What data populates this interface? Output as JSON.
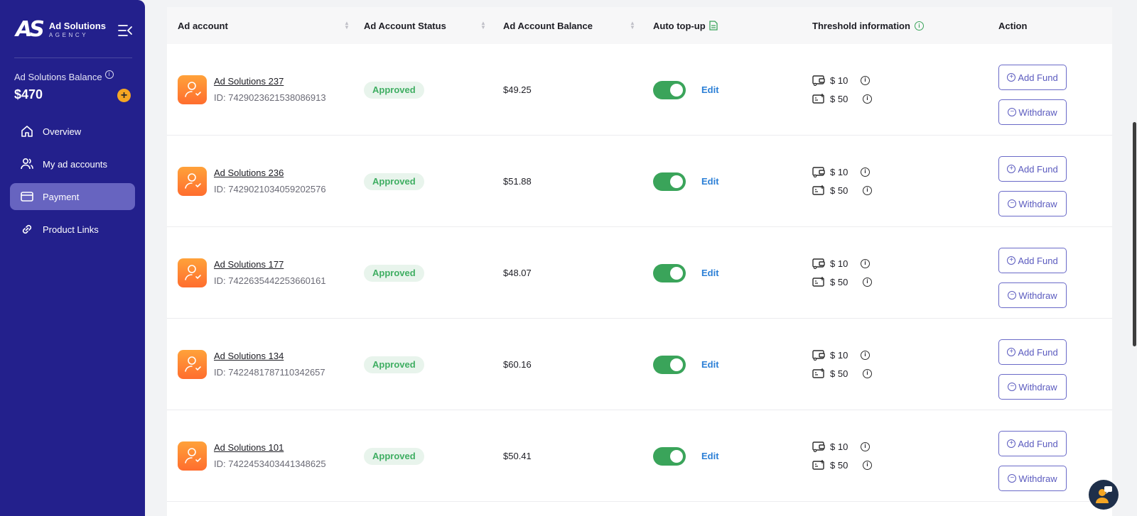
{
  "sidebar": {
    "logo_mark": "AS",
    "logo_title": "Ad Solutions",
    "logo_subtitle": "AGENCY",
    "balance_label": "Ad Solutions Balance",
    "balance_value": "$470",
    "add_symbol": "+",
    "items": [
      {
        "label": "Overview",
        "icon": "home-icon"
      },
      {
        "label": "My ad accounts",
        "icon": "users-icon"
      },
      {
        "label": "Payment",
        "icon": "card-icon",
        "active": true
      },
      {
        "label": "Product Links",
        "icon": "link-icon"
      }
    ]
  },
  "table": {
    "headers": {
      "account": "Ad account",
      "status": "Ad Account Status",
      "balance": "Ad Account Balance",
      "topup": "Auto top-up",
      "threshold": "Threshold information",
      "action": "Action"
    },
    "rows": [
      {
        "name": "Ad Solutions 237",
        "id": "ID: 7429023621538086913",
        "status": "Approved",
        "balance": "$49.25",
        "edit": "Edit",
        "threshold_min": "$ 10",
        "threshold_topup": "$ 50",
        "add_fund": "Add Fund",
        "withdraw": "Withdraw"
      },
      {
        "name": "Ad Solutions 236",
        "id": "ID: 7429021034059202576",
        "status": "Approved",
        "balance": "$51.88",
        "edit": "Edit",
        "threshold_min": "$ 10",
        "threshold_topup": "$ 50",
        "add_fund": "Add Fund",
        "withdraw": "Withdraw"
      },
      {
        "name": "Ad Solutions 177",
        "id": "ID: 7422635442253660161",
        "status": "Approved",
        "balance": "$48.07",
        "edit": "Edit",
        "threshold_min": "$ 10",
        "threshold_topup": "$ 50",
        "add_fund": "Add Fund",
        "withdraw": "Withdraw"
      },
      {
        "name": "Ad Solutions 134",
        "id": "ID: 7422481787110342657",
        "status": "Approved",
        "balance": "$60.16",
        "edit": "Edit",
        "threshold_min": "$ 10",
        "threshold_topup": "$ 50",
        "add_fund": "Add Fund",
        "withdraw": "Withdraw"
      },
      {
        "name": "Ad Solutions 101",
        "id": "ID: 7422453403441348625",
        "status": "Approved",
        "balance": "$50.41",
        "edit": "Edit",
        "threshold_min": "$ 10",
        "threshold_topup": "$ 50",
        "add_fund": "Add Fund",
        "withdraw": "Withdraw"
      }
    ]
  },
  "colors": {
    "sidebar_bg": "#23208c",
    "active_nav": "#6764c0",
    "approved": "#3fae62",
    "toggle_on": "#3aa45a",
    "edit_link": "#2b7fd6",
    "button_border": "#6a6ac8"
  }
}
